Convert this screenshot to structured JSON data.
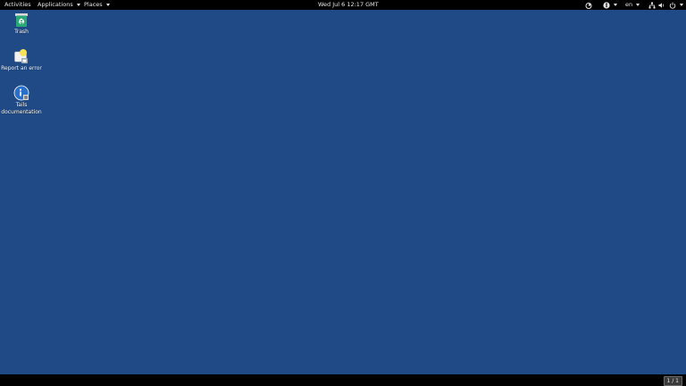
{
  "topbar": {
    "activities": "Activities",
    "applications": "Applications",
    "places": "Places",
    "clock": "Wed Jul 6  12:17 GMT",
    "language": "en"
  },
  "desktop": {
    "icons": [
      {
        "label": "Trash",
        "icon": "trash-icon"
      },
      {
        "label": "Report an error",
        "icon": "report-error-icon"
      },
      {
        "label": "Tails documentation",
        "icon": "tails-documentation-icon"
      }
    ]
  },
  "bottombar": {
    "workspace": "1 / 1"
  },
  "colors": {
    "desktop_background": "#1f4a86",
    "panel": "#000000"
  }
}
